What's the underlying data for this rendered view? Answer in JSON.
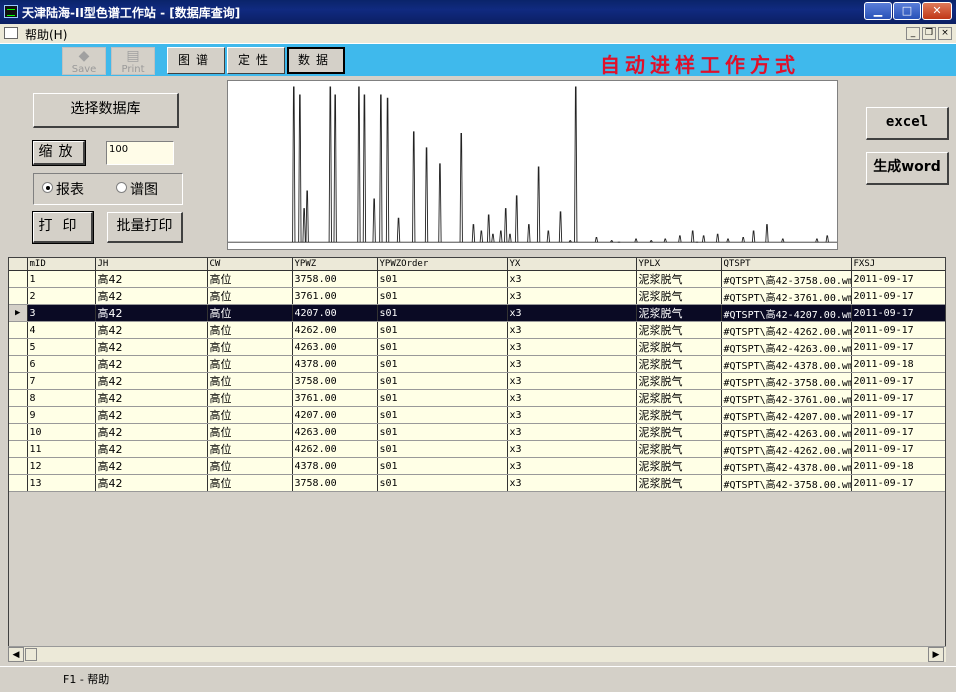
{
  "window": {
    "title": "天津陆海-II型色谱工作站 - [数据库查询]",
    "min_label": "▁",
    "max_label": "□",
    "close_label": "✕"
  },
  "menu": {
    "help": "帮助(H)",
    "mdi_min": "_",
    "mdi_restore": "❐",
    "mdi_close": "×"
  },
  "toolbar": {
    "save_label": "Save",
    "print_label": "Print",
    "tabs": [
      "图谱",
      "定性",
      "数据"
    ],
    "active_tab": "数据",
    "mode_text": "自动进样工作方式",
    "bg_color": "#3fb9ec",
    "mode_color": "#e0102a"
  },
  "left_panel": {
    "select_db": "选择数据库",
    "zoom": "缩放",
    "zoom_value": "100",
    "radio_report": "报表",
    "radio_spectrum": "谱图",
    "radio_selected": "报表",
    "print": "打印",
    "batch_print": "批量打印"
  },
  "right_panel": {
    "excel": "excel",
    "word": "生成word"
  },
  "grid": {
    "columns": [
      "mID",
      "JH",
      "CW",
      "YPWZ",
      "YPWZOrder",
      "YX",
      "YPLX",
      "QTSPT",
      "FXSJ"
    ],
    "selected_index": 2,
    "rows": [
      [
        "1",
        "高42",
        "高位",
        "3758.00",
        "s01",
        "x3",
        "泥浆脱气",
        "#QTSPT\\高42-3758.00.wmf",
        "2011-09-17"
      ],
      [
        "2",
        "高42",
        "高位",
        "3761.00",
        "s01",
        "x3",
        "泥浆脱气",
        "#QTSPT\\高42-3761.00.wmf",
        "2011-09-17"
      ],
      [
        "3",
        "高42",
        "高位",
        "4207.00",
        "s01",
        "x3",
        "泥浆脱气",
        "#QTSPT\\高42-4207.00.wmf",
        "2011-09-17"
      ],
      [
        "4",
        "高42",
        "高位",
        "4262.00",
        "s01",
        "x3",
        "泥浆脱气",
        "#QTSPT\\高42-4262.00.wmf",
        "2011-09-17"
      ],
      [
        "5",
        "高42",
        "高位",
        "4263.00",
        "s01",
        "x3",
        "泥浆脱气",
        "#QTSPT\\高42-4263.00.wmf",
        "2011-09-17"
      ],
      [
        "6",
        "高42",
        "高位",
        "4378.00",
        "s01",
        "x3",
        "泥浆脱气",
        "#QTSPT\\高42-4378.00.wmf",
        "2011-09-18"
      ],
      [
        "7",
        "高42",
        "高位",
        "3758.00",
        "s01",
        "x3",
        "泥浆脱气",
        "#QTSPT\\高42-3758.00.wmf",
        "2011-09-17"
      ],
      [
        "8",
        "高42",
        "高位",
        "3761.00",
        "s01",
        "x3",
        "泥浆脱气",
        "#QTSPT\\高42-3761.00.wmf",
        "2011-09-17"
      ],
      [
        "9",
        "高42",
        "高位",
        "4207.00",
        "s01",
        "x3",
        "泥浆脱气",
        "#QTSPT\\高42-4207.00.wmf",
        "2011-09-17"
      ],
      [
        "10",
        "高42",
        "高位",
        "4263.00",
        "s01",
        "x3",
        "泥浆脱气",
        "#QTSPT\\高42-4263.00.wmf",
        "2011-09-17"
      ],
      [
        "11",
        "高42",
        "高位",
        "4262.00",
        "s01",
        "x3",
        "泥浆脱气",
        "#QTSPT\\高42-4262.00.wmf",
        "2011-09-17"
      ],
      [
        "12",
        "高42",
        "高位",
        "4378.00",
        "s01",
        "x3",
        "泥浆脱气",
        "#QTSPT\\高42-4378.00.wmf",
        "2011-09-18"
      ],
      [
        "13",
        "高42",
        "高位",
        "3758.00",
        "s01",
        "x3",
        "泥浆脱气",
        "#QTSPT\\高42-3758.00.wmf",
        "2011-09-17"
      ]
    ]
  },
  "status": {
    "text": "F1 - 帮助"
  },
  "chart_data": {
    "type": "line",
    "title": "",
    "xlabel": "",
    "ylabel": "",
    "ylim": [
      0,
      100
    ],
    "xlim": [
      0,
      100
    ],
    "baseline": 3,
    "peaks": [
      {
        "x": 10.8,
        "h": 100
      },
      {
        "x": 11.8,
        "h": 95
      },
      {
        "x": 12.5,
        "h": 24
      },
      {
        "x": 13.0,
        "h": 35
      },
      {
        "x": 16.8,
        "h": 100
      },
      {
        "x": 17.6,
        "h": 95
      },
      {
        "x": 21.5,
        "h": 100
      },
      {
        "x": 22.4,
        "h": 95
      },
      {
        "x": 24.0,
        "h": 30
      },
      {
        "x": 25.1,
        "h": 95
      },
      {
        "x": 26.2,
        "h": 93
      },
      {
        "x": 28.0,
        "h": 18
      },
      {
        "x": 30.5,
        "h": 72
      },
      {
        "x": 32.6,
        "h": 62
      },
      {
        "x": 34.8,
        "h": 52
      },
      {
        "x": 38.3,
        "h": 71
      },
      {
        "x": 40.3,
        "h": 14
      },
      {
        "x": 41.6,
        "h": 10
      },
      {
        "x": 42.8,
        "h": 20
      },
      {
        "x": 43.5,
        "h": 8
      },
      {
        "x": 44.8,
        "h": 10
      },
      {
        "x": 45.6,
        "h": 24
      },
      {
        "x": 46.3,
        "h": 8
      },
      {
        "x": 47.4,
        "h": 32
      },
      {
        "x": 49.4,
        "h": 14
      },
      {
        "x": 51.0,
        "h": 50
      },
      {
        "x": 52.6,
        "h": 10
      },
      {
        "x": 54.6,
        "h": 22
      },
      {
        "x": 56.2,
        "h": 4
      },
      {
        "x": 57.1,
        "h": 100
      },
      {
        "x": 60.5,
        "h": 6
      },
      {
        "x": 63.0,
        "h": 4
      },
      {
        "x": 64.2,
        "h": 3
      },
      {
        "x": 67.0,
        "h": 5
      },
      {
        "x": 69.5,
        "h": 4
      },
      {
        "x": 71.8,
        "h": 5
      },
      {
        "x": 74.2,
        "h": 7
      },
      {
        "x": 76.3,
        "h": 10
      },
      {
        "x": 77.0,
        "h": 3
      },
      {
        "x": 78.1,
        "h": 7
      },
      {
        "x": 80.4,
        "h": 8
      },
      {
        "x": 82.1,
        "h": 5
      },
      {
        "x": 84.6,
        "h": 6
      },
      {
        "x": 86.3,
        "h": 10
      },
      {
        "x": 88.5,
        "h": 14
      },
      {
        "x": 91.1,
        "h": 5
      },
      {
        "x": 96.7,
        "h": 5
      },
      {
        "x": 98.4,
        "h": 7
      }
    ]
  }
}
